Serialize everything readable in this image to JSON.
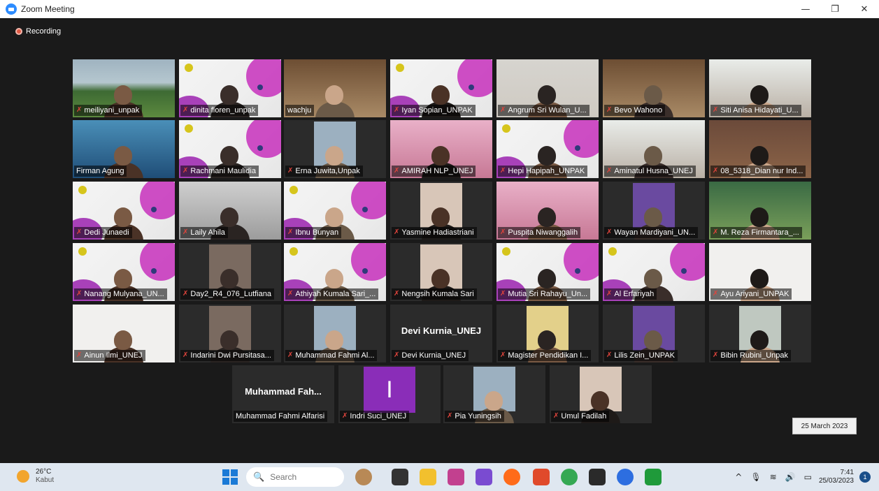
{
  "window": {
    "title": "Zoom Meeting",
    "minimize_glyph": "—",
    "restore_glyph": "❐",
    "close_glyph": "✕"
  },
  "recording": {
    "label": "Recording"
  },
  "participants": [
    {
      "name": "meiliyani_unpak",
      "muted": true
    },
    {
      "name": "dinita floren_unpak",
      "muted": true
    },
    {
      "name": "wachju",
      "muted": false
    },
    {
      "name": "Iyan Sopian_UNPAK",
      "muted": true
    },
    {
      "name": "Angrum Sri Wulan_U...",
      "muted": true
    },
    {
      "name": "Bevo Wahono",
      "muted": true
    },
    {
      "name": "Siti Anisa Hidayati_U...",
      "muted": true
    },
    {
      "name": "Firman Agung",
      "muted": false
    },
    {
      "name": "Rachmani Maulidia",
      "muted": true
    },
    {
      "name": "Erna Juwita,Unpak",
      "muted": true
    },
    {
      "name": "AMIRAH NLP_UNEJ",
      "muted": true
    },
    {
      "name": "Hepi Hapipah_UNPAK",
      "muted": true
    },
    {
      "name": "Aminatul Husna_UNEJ",
      "muted": true
    },
    {
      "name": "08_5318_Dian nur Ind...",
      "muted": true
    },
    {
      "name": "Dedi Junaedi",
      "muted": true
    },
    {
      "name": "Laily Ahila",
      "muted": true
    },
    {
      "name": "Ibnu Bunyan",
      "muted": true
    },
    {
      "name": "Yasmine Hadiastriani",
      "muted": true
    },
    {
      "name": "Puspita Niwanggalih",
      "muted": true
    },
    {
      "name": "Wayan Mardiyani_UN...",
      "muted": true
    },
    {
      "name": "M. Reza Firmantara_...",
      "muted": true
    },
    {
      "name": "Nanang Mulyana_UN...",
      "muted": true
    },
    {
      "name": "Day2_R4_076_Lutfiana",
      "muted": true
    },
    {
      "name": "Athiyah Kumala Sari_...",
      "muted": true
    },
    {
      "name": "Nengsih Kumala Sari",
      "muted": true
    },
    {
      "name": "Mutia Sri Rahayu_Un...",
      "muted": true
    },
    {
      "name": "Al Erfariyah",
      "muted": true
    },
    {
      "name": "Ayu Ariyani_UNPAK",
      "muted": true
    },
    {
      "name": "Ainun Ilmi_UNEJ",
      "muted": true
    },
    {
      "name": "Indarini Dwi Pursitasa...",
      "muted": true
    },
    {
      "name": "Muhammad Fahmi Al...",
      "muted": true
    },
    {
      "name": "Devi Kurnia_UNEJ",
      "muted": true,
      "bigname": "Devi Kurnia_UNEJ"
    },
    {
      "name": "Magister Pendidikan I...",
      "muted": true
    },
    {
      "name": "Lilis Zein_UNPAK",
      "muted": true
    },
    {
      "name": "Bibin Rubini_Unpak",
      "muted": true
    },
    {
      "name": "Muhammad Fahmi Alfarisi",
      "muted": false,
      "bigname": "Muhammad  Fah..."
    },
    {
      "name": "Indri Suci_UNEJ",
      "muted": true,
      "initial": "I"
    },
    {
      "name": "Pia Yuningsih",
      "muted": true
    },
    {
      "name": "Umul Fadilah",
      "muted": true
    }
  ],
  "date_overlay": "25 March 2023",
  "taskbar": {
    "weather_temp": "26°C",
    "weather_desc": "Kabut",
    "search_placeholder": "Search",
    "tray_up": "^",
    "tray_mic": "🎙",
    "tray_wifi": "≋",
    "tray_volume": "🔊",
    "tray_battery": "▭",
    "time": "7:41",
    "date": "25/03/2023",
    "notifications": "1",
    "search_glyph": "🔍",
    "app_icons": [
      "shell-icon",
      "taskview-icon",
      "file-explorer-icon",
      "photos-icon",
      "collab-icon",
      "firefox-icon",
      "snip-icon",
      "chrome-icon",
      "store-icon",
      "zoom-icon",
      "xbox-icon"
    ],
    "app_colors": [
      "#b88956",
      "#333333",
      "#f2c02e",
      "#c2408f",
      "#7a4bd1",
      "#ff6b1a",
      "#e04a2b",
      "#34a853",
      "#2a2a2a",
      "#2d6ee0",
      "#1f9a3a"
    ]
  }
}
